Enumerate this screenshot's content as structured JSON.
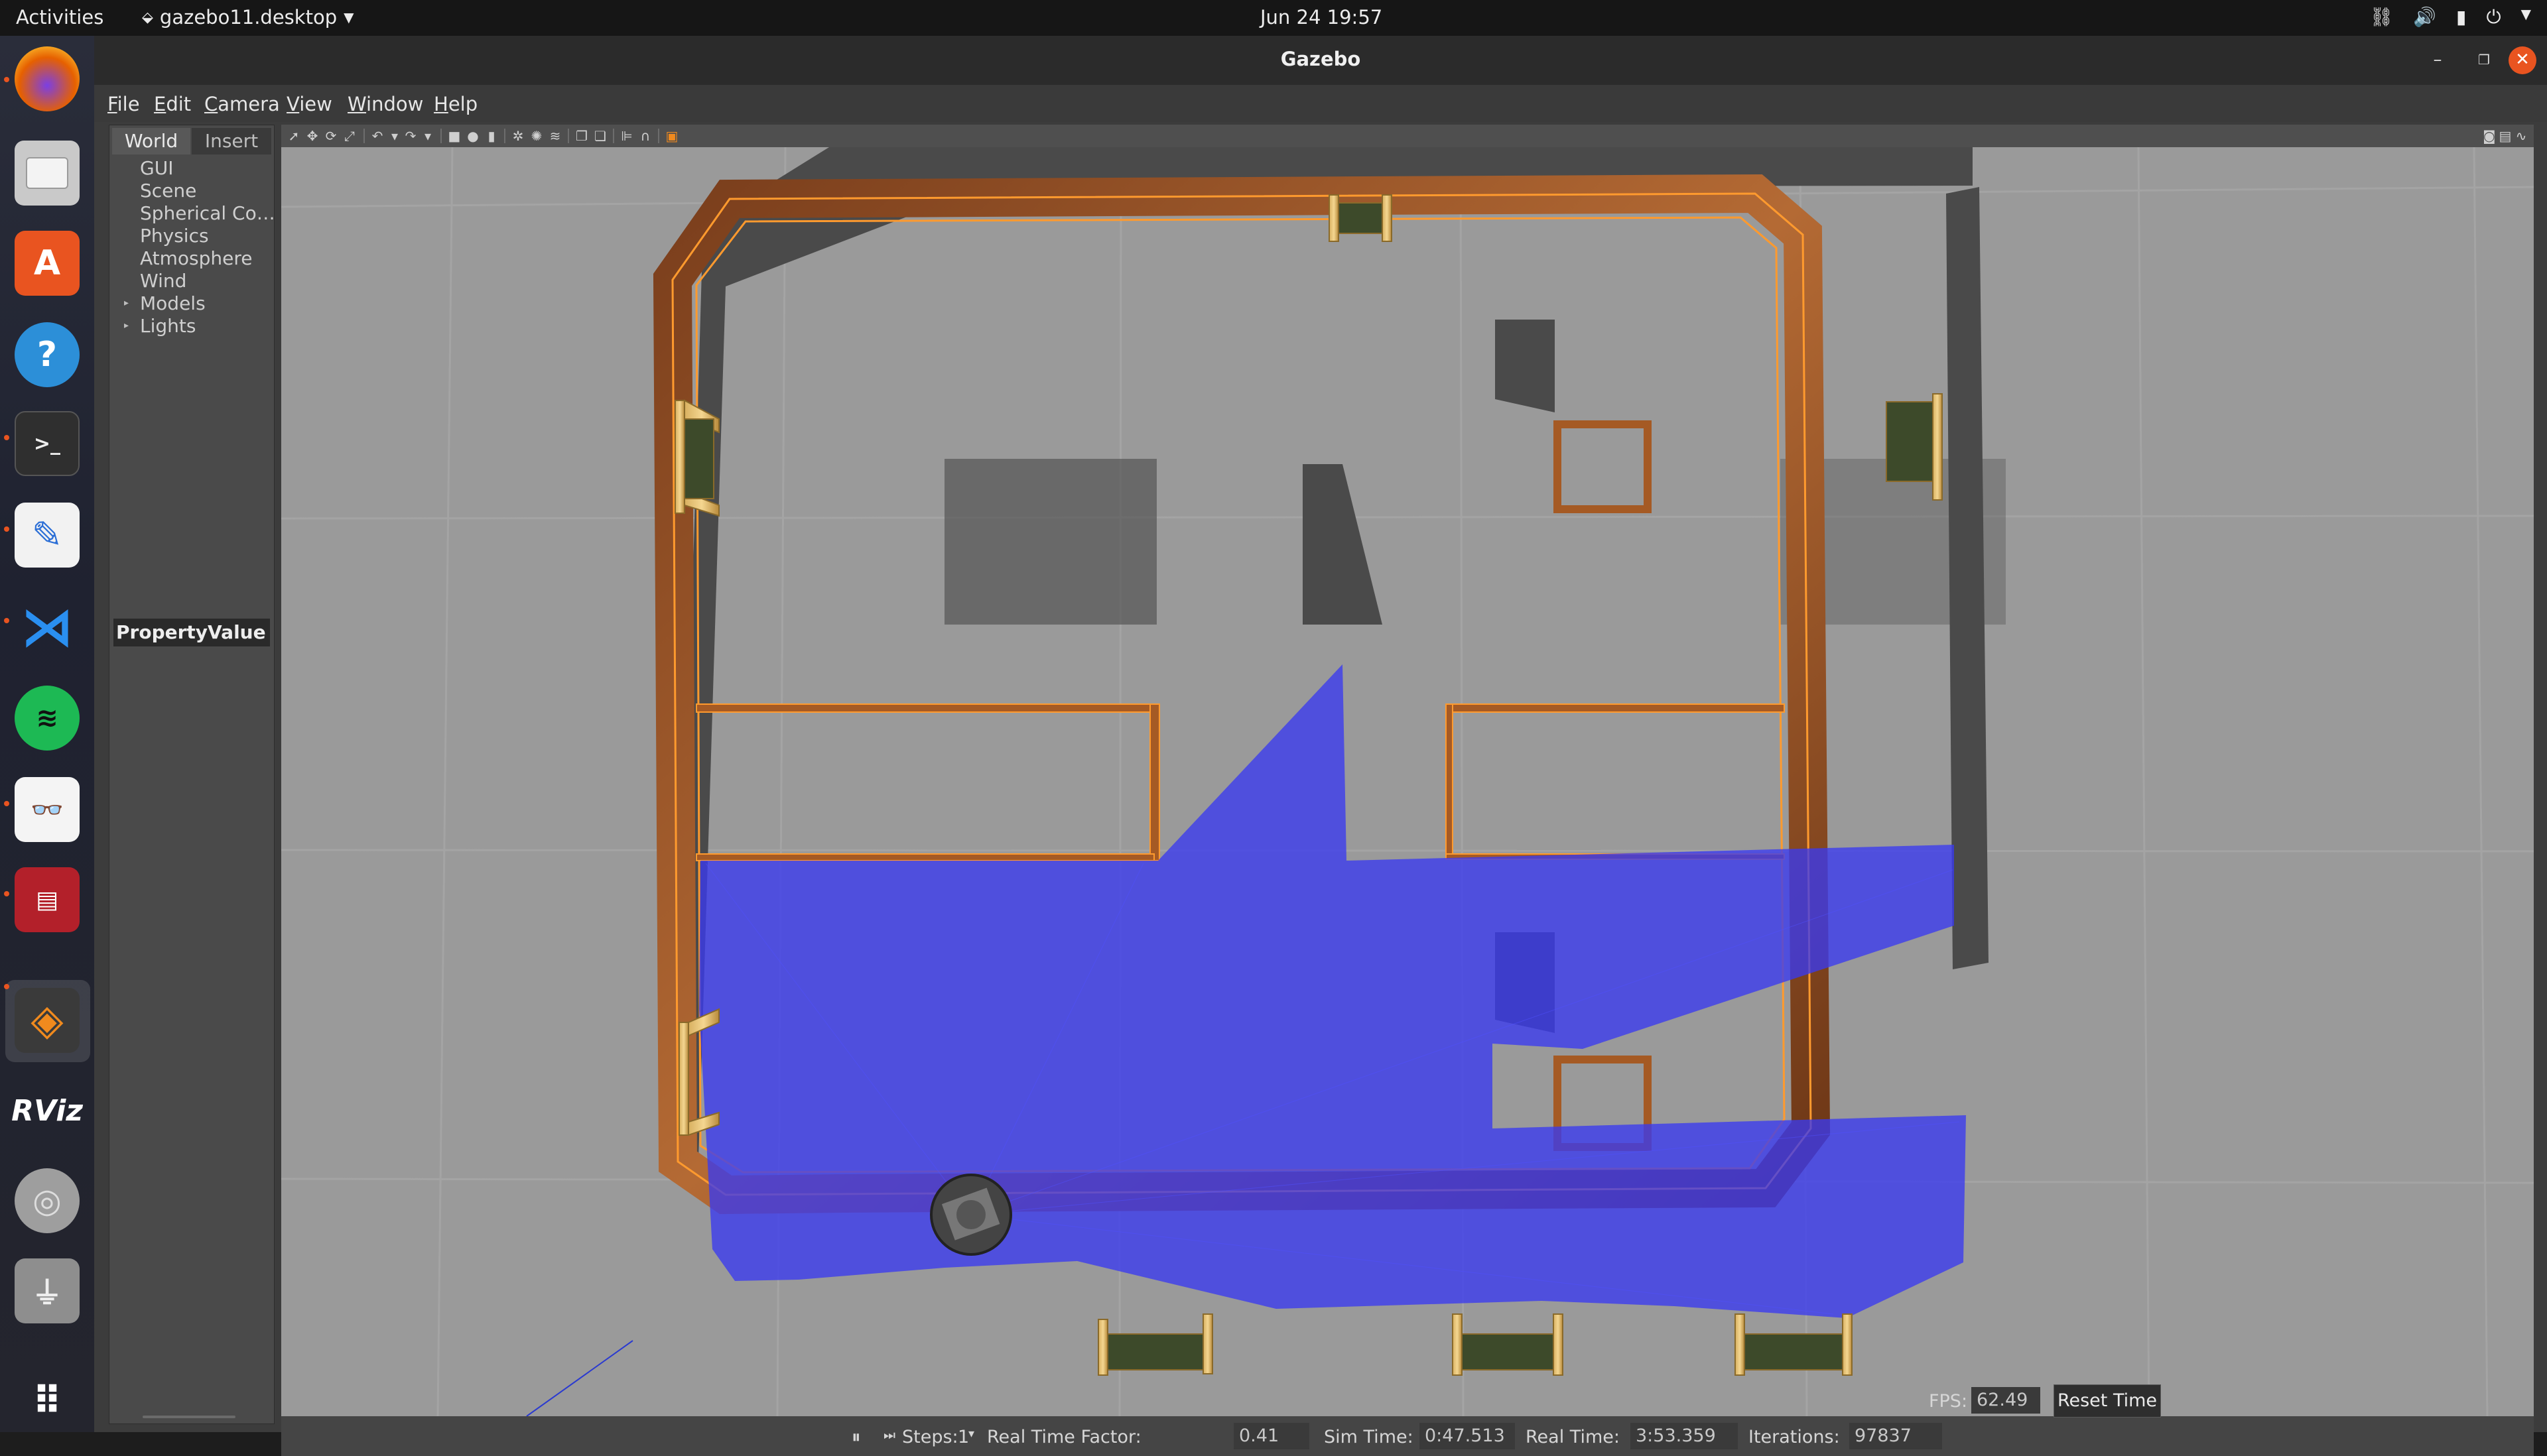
{
  "topbar": {
    "activities": "Activities",
    "app_menu": "gazebo11.desktop",
    "clock": "Jun 24  19:57"
  },
  "window": {
    "title": "Gazebo"
  },
  "menu": [
    "File",
    "Edit",
    "Camera",
    "View",
    "Window",
    "Help"
  ],
  "left_panel": {
    "tabs": [
      "World",
      "Insert"
    ],
    "tree": [
      "GUI",
      "Scene",
      "Spherical Co…",
      "Physics",
      "Atmosphere",
      "Wind",
      "Models",
      "Lights"
    ],
    "property_header": "PropertyValue"
  },
  "status": {
    "pause": "⏸",
    "steps_label": "Steps:",
    "steps_value": "1",
    "rtf_label": "Real Time Factor:",
    "rtf_value": "0.41",
    "sim_time_label": "Sim Time:",
    "sim_time_value": "0:47.513",
    "real_time_label": "Real Time:",
    "real_time_value": "3:53.359",
    "iterations_label": "Iterations:",
    "iterations_value": "97837",
    "fps_label": "FPS:",
    "fps_value": "62.49",
    "reset_button": "Reset Time"
  },
  "dock": {
    "icons": [
      "firefox-icon",
      "files-icon",
      "software-center-icon",
      "help-icon",
      "terminal-icon",
      "text-editor-icon",
      "vscode-icon",
      "spotify-icon",
      "document-viewer-icon",
      "system-monitor-icon",
      "gazebo-icon",
      "rviz-icon",
      "disc-icon",
      "usb-icon",
      "show-apps-icon"
    ],
    "rviz_label": "RViz"
  },
  "colors": {
    "laser": "#3a3af0",
    "wall_wood": "#a0592a",
    "wall_edge": "#ff9a2e",
    "floor": "#9a9a9a",
    "accent": "#e95420"
  }
}
